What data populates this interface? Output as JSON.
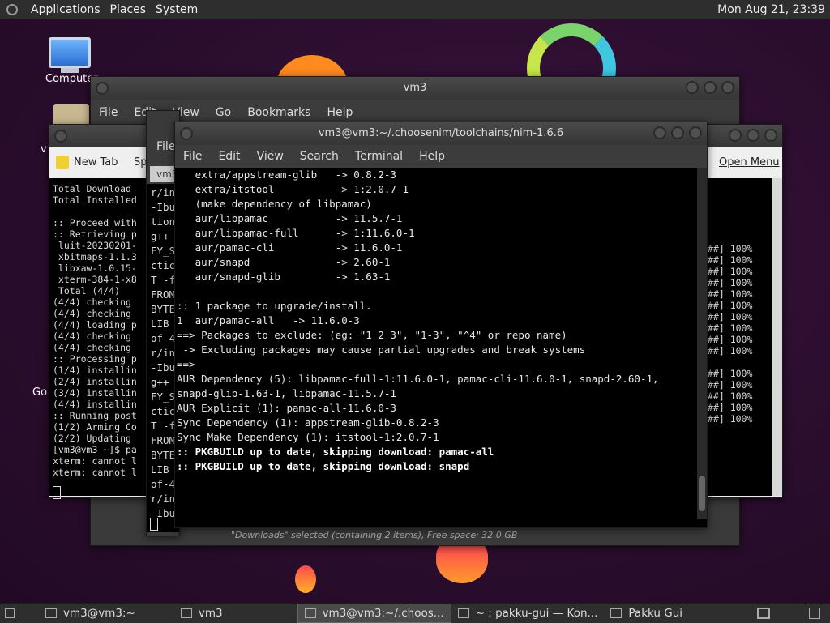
{
  "top_panel": {
    "menus": [
      "Applications",
      "Places",
      "System"
    ],
    "clock": "Mon Aug 21, 23:39"
  },
  "desktop": {
    "icons": [
      {
        "label": "Computer"
      },
      {
        "label": "v"
      }
    ],
    "partial_label": "Go"
  },
  "vm3_window": {
    "title": "vm3",
    "menu": [
      "File",
      "Edit",
      "View",
      "Go",
      "Bookmarks",
      "Help"
    ],
    "status": "\"Downloads\" selected (containing 2 items), Free space: 32.0 GB"
  },
  "konsole": {
    "new_tab": "New Tab",
    "split": "Spl",
    "open_menu": "Open Menu",
    "left_lines": [
      "Total Download",
      "Total Installed",
      "",
      ":: Proceed with",
      ":: Retrieving p",
      " luit-20230201-",
      " xbitmaps-1.1.3",
      " libxaw-1.0.15-",
      " xterm-384-1-x8",
      " Total (4/4)",
      "(4/4) checking",
      "(4/4) checking",
      "(4/4) loading p",
      "(4/4) checking",
      "(4/4) checking",
      ":: Processing p",
      "(1/4) installin",
      "(2/4) installin",
      "(3/4) installin",
      "(4/4) installin",
      ":: Running post",
      "(1/2) Arming Co",
      "(2/2) Updating",
      "[vm3@vm3 ~]$ pa",
      "xterm: cannot l",
      "xterm: cannot l"
    ],
    "right_lines": [
      "##] 100%",
      "##] 100%",
      "##] 100%",
      "##] 100%",
      "##] 100%",
      "##] 100%",
      "##] 100%",
      "##] 100%",
      "##] 100%",
      "##] 100%",
      "",
      "##] 100%",
      "##] 100%",
      "##] 100%",
      "##] 100%",
      "##] 100%"
    ]
  },
  "back_terminal": {
    "menu": [
      "File"
    ],
    "tab": "vm3",
    "lines": [
      "r/in",
      "-Ibu",
      "tion",
      "g++",
      "FY_S",
      "ctic",
      "T -f",
      "FROM",
      "BYTE",
      "LIB",
      "of-4",
      "r/in",
      "-Ibu",
      "g++",
      "FY_S",
      "ctic",
      "T -f",
      "FROM",
      "BYTE",
      "LIB",
      "of-4",
      "r/in",
      "-Ibu"
    ]
  },
  "front_terminal": {
    "title": "vm3@vm3:~/.choosenim/toolchains/nim-1.6.6",
    "menu": [
      "File",
      "Edit",
      "View",
      "Search",
      "Terminal",
      "Help"
    ],
    "lines": [
      {
        "text": "   extra/appstream-glib   -> 0.8.2-3",
        "bold": false
      },
      {
        "text": "   extra/itstool          -> 1:2.0.7-1",
        "bold": false
      },
      {
        "text": "   (make dependency of libpamac)",
        "bold": false
      },
      {
        "text": "   aur/libpamac           -> 11.5.7-1",
        "bold": false
      },
      {
        "text": "   aur/libpamac-full      -> 1:11.6.0-1",
        "bold": false
      },
      {
        "text": "   aur/pamac-cli          -> 11.6.0-1",
        "bold": false
      },
      {
        "text": "   aur/snapd              -> 2.60-1",
        "bold": false
      },
      {
        "text": "   aur/snapd-glib         -> 1.63-1",
        "bold": false
      },
      {
        "text": "",
        "bold": false
      },
      {
        "text": ":: 1 package to upgrade/install.",
        "bold": false
      },
      {
        "text": "1  aur/pamac-all   -> 11.6.0-3",
        "bold": false
      },
      {
        "text": "==> Packages to exclude: (eg: \"1 2 3\", \"1-3\", \"^4\" or repo name)",
        "bold": false
      },
      {
        "text": " -> Excluding packages may cause partial upgrades and break systems",
        "bold": false
      },
      {
        "text": "==>",
        "bold": false
      },
      {
        "text": "AUR Dependency (5): libpamac-full-1:11.6.0-1, pamac-cli-11.6.0-1, snapd-2.60-1,",
        "bold": false
      },
      {
        "text": "snapd-glib-1.63-1, libpamac-11.5.7-1",
        "bold": false
      },
      {
        "text": "AUR Explicit (1): pamac-all-11.6.0-3",
        "bold": false
      },
      {
        "text": "Sync Dependency (1): appstream-glib-0.8.2-3",
        "bold": false
      },
      {
        "text": "Sync Make Dependency (1): itstool-1:2.0.7-1",
        "bold": false
      },
      {
        "text": ":: PKGBUILD up to date, skipping download: pamac-all",
        "bold": true
      },
      {
        "text": ":: PKGBUILD up to date, skipping download: snapd",
        "bold": true
      }
    ]
  },
  "taskbar": {
    "tasks": [
      {
        "label": "vm3@vm3:~",
        "active": false
      },
      {
        "label": "vm3",
        "active": false
      },
      {
        "label": "vm3@vm3:~/.choos...",
        "active": true
      },
      {
        "label": "~ : pakku-gui — Kon...",
        "active": false
      },
      {
        "label": "Pakku Gui",
        "active": false
      }
    ]
  }
}
